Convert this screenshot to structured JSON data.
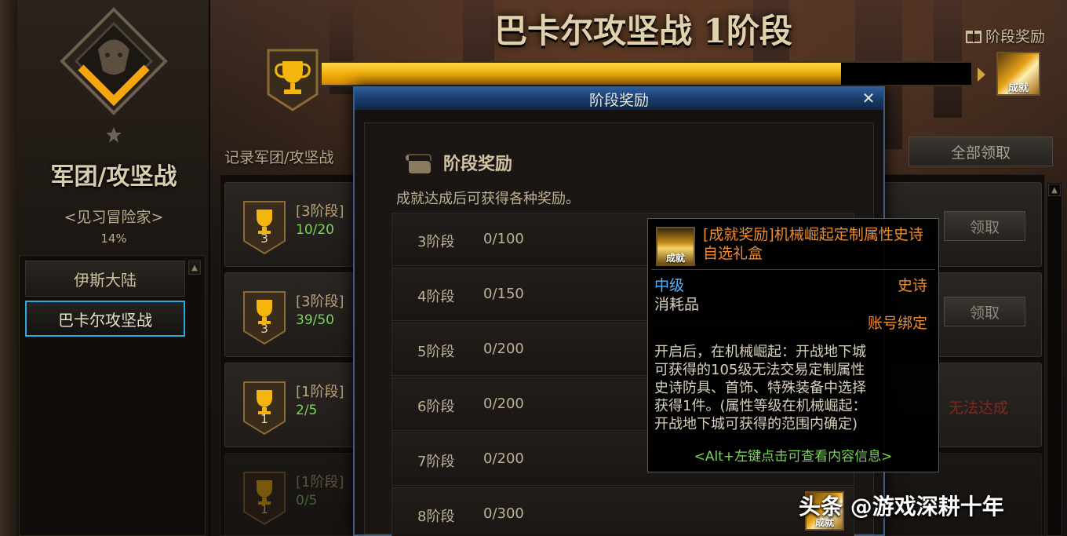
{
  "header": {
    "title": "巴卡尔攻坚战 1阶段",
    "stage_reward_link": "阶段奖励",
    "claim_all": "全部领取",
    "record_label": "记录军团/攻坚战",
    "progress_fraction": 0.8,
    "final_reward_icon_text": "成就"
  },
  "sidebar": {
    "title": "军团/攻坚战",
    "rank": "<见习冒险家>",
    "percent": "14%",
    "items": [
      {
        "label": "伊斯大陆"
      },
      {
        "label": "巴卡尔攻坚战"
      }
    ]
  },
  "missions": [
    {
      "stage": "[3阶段]",
      "badge": "3",
      "progress": "10/20",
      "claim": "领取"
    },
    {
      "stage": "[3阶段]",
      "badge": "3",
      "progress": "39/50",
      "claim": "领取"
    },
    {
      "stage": "[1阶段]",
      "badge": "1",
      "progress": "2/5",
      "status": "无法达成"
    },
    {
      "stage": "[1阶段]",
      "badge": "1",
      "progress": "0/5"
    }
  ],
  "modal": {
    "title": "阶段奖励",
    "heading": "阶段奖励",
    "description": "成就达成后可获得各种奖励。",
    "stages": [
      {
        "name": "3阶段",
        "count": "0/100"
      },
      {
        "name": "4阶段",
        "count": "0/150"
      },
      {
        "name": "5阶段",
        "count": "0/200"
      },
      {
        "name": "6阶段",
        "count": "0/200"
      },
      {
        "name": "7阶段",
        "count": "0/200"
      },
      {
        "name": "8阶段",
        "count": "0/300"
      }
    ],
    "reward_icon_text": "成就"
  },
  "tooltip": {
    "icon_text": "成就",
    "name": "[成就奖励]机械崛起定制属性史诗自选礼盒",
    "level": "中级",
    "rarity": "史诗",
    "type": "消耗品",
    "bind": "账号绑定",
    "description": "开启后，在机械崛起：开战地下城\n可获得的105级无法交易定制属性\n史诗防具、首饰、特殊装备中选择\n获得1件。(属性等级在机械崛起：\n开战地下城可获得的范围内确定)",
    "hint": "<Alt+左键点击可查看内容信息>"
  },
  "watermark": "头条 @游戏深耕十年"
}
